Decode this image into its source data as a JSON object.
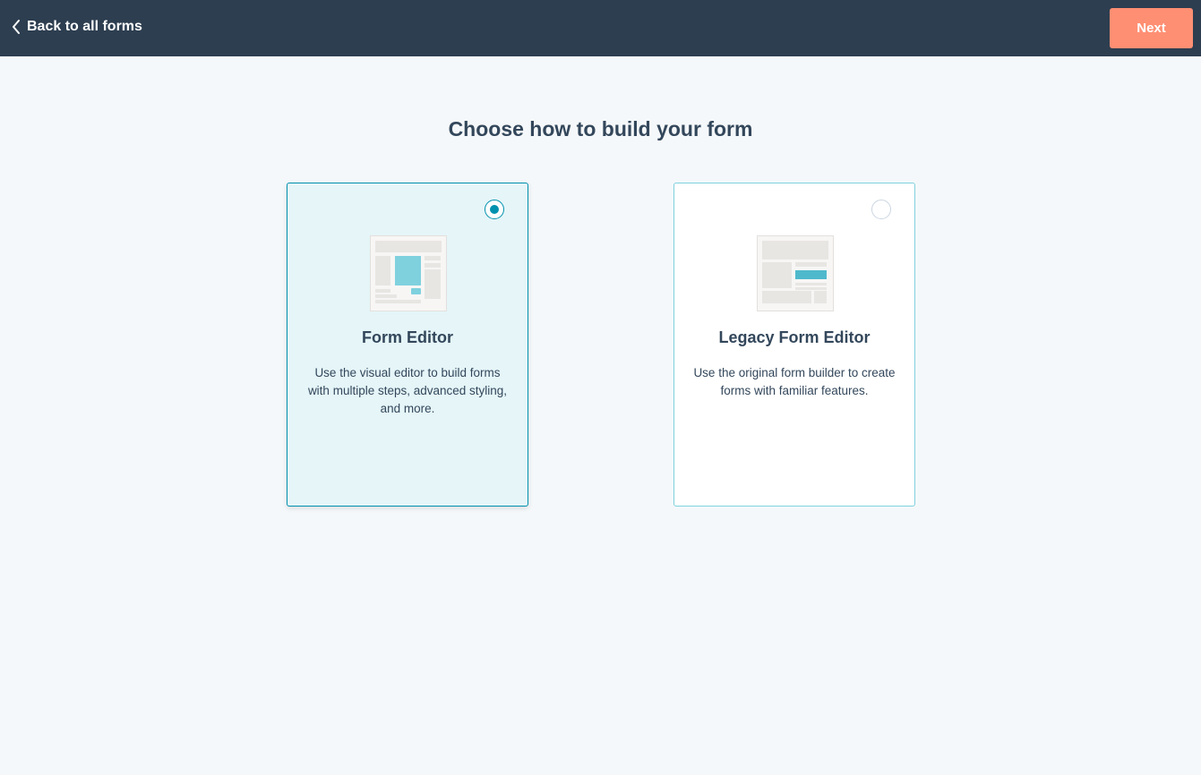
{
  "header": {
    "back_label": "Back to all forms",
    "next_label": "Next"
  },
  "page": {
    "title": "Choose how to build your form"
  },
  "options": [
    {
      "title": "Form Editor",
      "description": "Use the visual editor to build forms with multiple steps, advanced styling, and more.",
      "selected": true,
      "illustration": "form-editor-layout-icon"
    },
    {
      "title": "Legacy Form Editor",
      "description": "Use the original form builder to create forms with familiar features.",
      "selected": false,
      "illustration": "legacy-form-layout-icon"
    }
  ],
  "colors": {
    "header_bg": "#2d3e50",
    "next_button": "#ff8f73",
    "selected_border": "#0091ae",
    "selected_bg": "#e5f5f8",
    "accent_teal": "#7fd1de"
  }
}
